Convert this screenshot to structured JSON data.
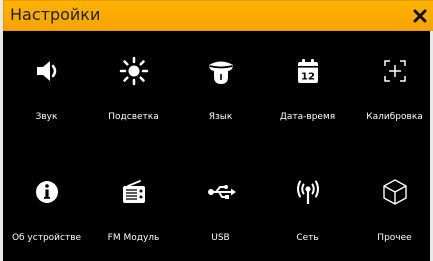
{
  "window": {
    "title": "Настройки"
  },
  "items": [
    {
      "label": "Звук",
      "icon": "speaker-icon"
    },
    {
      "label": "Подсветка",
      "icon": "sun-icon"
    },
    {
      "label": "Язык",
      "icon": "tongue-icon"
    },
    {
      "label": "Дата-время",
      "icon": "calendar-icon",
      "icon_text": "12"
    },
    {
      "label": "Калибровка",
      "icon": "crosshair-icon"
    },
    {
      "label": "Об устройстве",
      "icon": "info-icon"
    },
    {
      "label": "FM Модуль",
      "icon": "radio-icon"
    },
    {
      "label": "USB",
      "icon": "usb-icon"
    },
    {
      "label": "Сеть",
      "icon": "antenna-icon"
    },
    {
      "label": "Прочее",
      "icon": "cube-icon"
    }
  ],
  "colors": {
    "titlebar": "#ffb300",
    "background": "#000000",
    "text": "#ffffff"
  }
}
